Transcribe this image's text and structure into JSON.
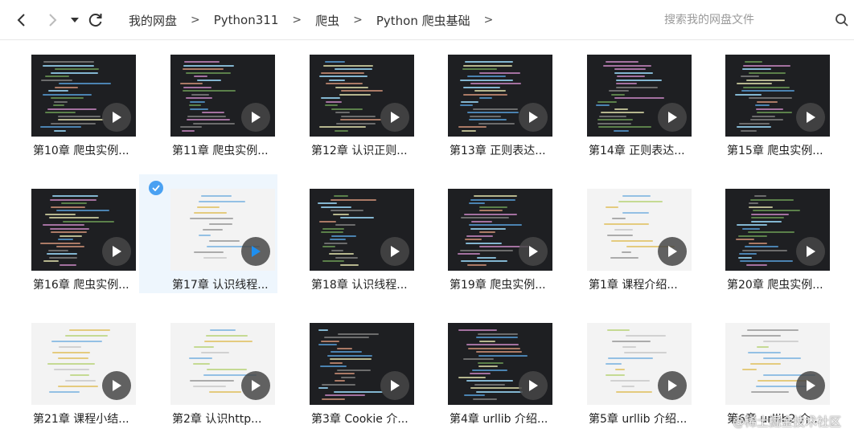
{
  "nav": {
    "back_icon": "chevron-left-icon",
    "forward_icon": "chevron-right-icon",
    "dropdown_icon": "caret-down-icon",
    "refresh_icon": "refresh-icon"
  },
  "breadcrumb": [
    "我的网盘",
    "Python311",
    "爬虫",
    "Python 爬虫基础"
  ],
  "breadcrumb_separator": ">",
  "search": {
    "placeholder": "搜索我的网盘文件",
    "value": ""
  },
  "files": [
    {
      "label": "第10章 爬虫实例...",
      "theme": "dark"
    },
    {
      "label": "第11章 爬虫实例...",
      "theme": "dark"
    },
    {
      "label": "第12章 认识正则...",
      "theme": "dark"
    },
    {
      "label": "第13章 正则表达...",
      "theme": "dark"
    },
    {
      "label": "第14章 正则表达...",
      "theme": "dark"
    },
    {
      "label": "第15章 爬虫实例...",
      "theme": "dark"
    },
    {
      "label": "第16章 爬虫实例...",
      "theme": "dark"
    },
    {
      "label": "第17章 认识线程...",
      "theme": "light",
      "selected": true
    },
    {
      "label": "第18章 认识线程...",
      "theme": "dark"
    },
    {
      "label": "第19章 爬虫实例...",
      "theme": "dark"
    },
    {
      "label": "第1章 课程介绍...",
      "theme": "light"
    },
    {
      "label": "第20章 爬虫实例...",
      "theme": "dark"
    },
    {
      "label": "第21章 课程小结...",
      "theme": "light"
    },
    {
      "label": "第2章 认识http...",
      "theme": "light"
    },
    {
      "label": "第3章 Cookie 介...",
      "theme": "dark"
    },
    {
      "label": "第4章 urllib 介绍...",
      "theme": "dark"
    },
    {
      "label": "第5章 urllib 介绍...",
      "theme": "light"
    },
    {
      "label": "第6章 urllib2 介...",
      "theme": "light"
    }
  ],
  "watermark": "@稀土掘金技术社区",
  "colors": {
    "selected_bg": "#eef6fd",
    "check_blue": "#4aa1f2",
    "play_blue": "#1e8ff0"
  }
}
